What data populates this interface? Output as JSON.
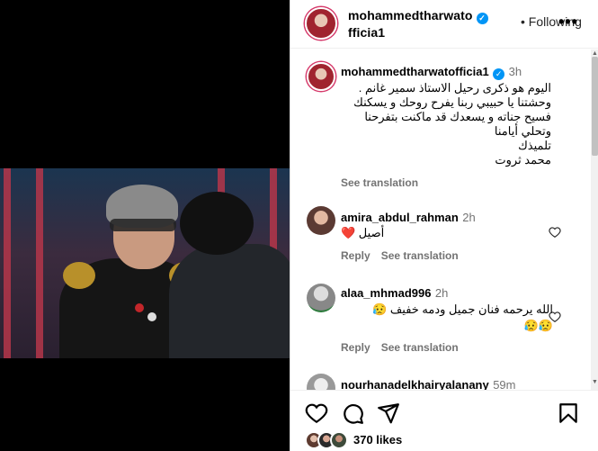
{
  "post": {
    "author": "mohammedtharwatofficia1",
    "author_line1": "mohammedtharwato",
    "author_line2": "fficia1",
    "follow_label": "Following",
    "more_label": "•••"
  },
  "caption": {
    "user": "mohammedtharwatofficia1",
    "time": "3h",
    "lines": [
      "اليوم هو ذكرى رحيل الاستاذ سمير غانم .",
      "وحشتنا يا حبيبي ربنا يفرح روحك و يسكنك",
      "فسيح جناته و يسعدك قد ماكنت بتفرحنا",
      "وتحلي أيامنا",
      "تلميذك",
      "محمد ثروت"
    ],
    "see_translation": "See translation"
  },
  "comments": [
    {
      "user": "amira_abdul_rahman",
      "time": "2h",
      "text": "أصيل ❤️",
      "reply": "Reply",
      "see_translation": "See translation"
    },
    {
      "user": "alaa_mhmad996",
      "time": "2h",
      "text": "الله يرحمه فنان جميل ودمه خفيف 😥",
      "text2": "😥😥",
      "reply": "Reply",
      "see_translation": "See translation"
    },
    {
      "user": "nourhanadelkhairyalanany",
      "time": "59m"
    }
  ],
  "footer": {
    "likes": "370 likes"
  },
  "icons": {
    "verified": "verified-badge-icon",
    "like": "heart-icon",
    "comment": "comment-icon",
    "share": "paper-plane-icon",
    "save": "bookmark-icon"
  },
  "colors": {
    "verified": "#0095f6",
    "meta": "#737373",
    "heart": "#e0245e"
  }
}
